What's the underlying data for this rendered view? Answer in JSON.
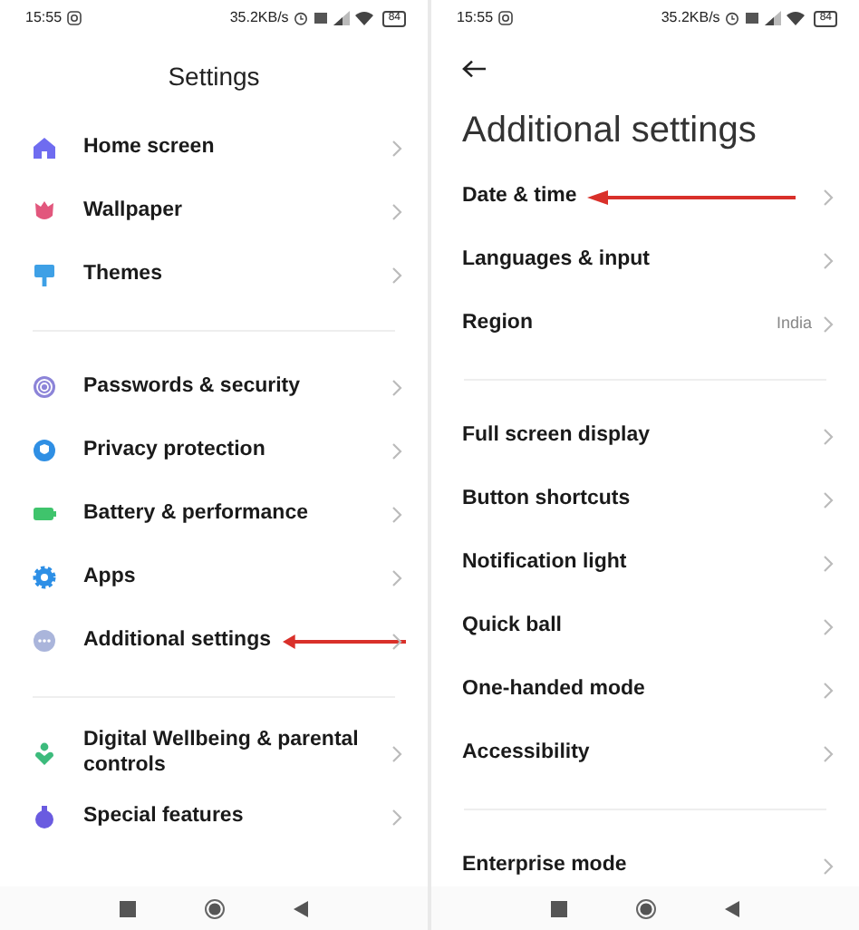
{
  "screens": [
    {
      "kind": "root",
      "status_bar": {
        "time": "15:55",
        "speed": "35.2KB/s",
        "battery": "84"
      },
      "title": "Settings",
      "groups": [
        [
          {
            "label": "Home screen",
            "annotated": false
          },
          {
            "label": "Wallpaper",
            "annotated": false
          },
          {
            "label": "Themes",
            "annotated": false
          }
        ],
        [
          {
            "label": "Passwords & security",
            "annotated": false
          },
          {
            "label": "Privacy protection",
            "annotated": false
          },
          {
            "label": "Battery & performance",
            "annotated": false
          },
          {
            "label": "Apps",
            "annotated": false
          },
          {
            "label": "Additional settings",
            "annotated": true
          }
        ],
        [
          {
            "label": "Digital Wellbeing & parental controls",
            "annotated": false
          },
          {
            "label": "Special features",
            "annotated": false
          }
        ]
      ]
    },
    {
      "kind": "subpage",
      "status_bar": {
        "time": "15:55",
        "speed": "35.2KB/s",
        "battery": "84"
      },
      "title": "Additional settings",
      "groups": [
        [
          {
            "label": "Date & time",
            "annotated": true
          },
          {
            "label": "Languages & input",
            "annotated": false
          },
          {
            "label": "Region",
            "value": "India",
            "annotated": false
          }
        ],
        [
          {
            "label": "Full screen display",
            "annotated": false
          },
          {
            "label": "Button shortcuts",
            "annotated": false
          },
          {
            "label": "Notification light",
            "annotated": false
          },
          {
            "label": "Quick ball",
            "annotated": false
          },
          {
            "label": "One-handed mode",
            "annotated": false
          },
          {
            "label": "Accessibility",
            "annotated": false
          }
        ],
        [
          {
            "label": "Enterprise mode",
            "annotated": false
          }
        ]
      ]
    }
  ]
}
